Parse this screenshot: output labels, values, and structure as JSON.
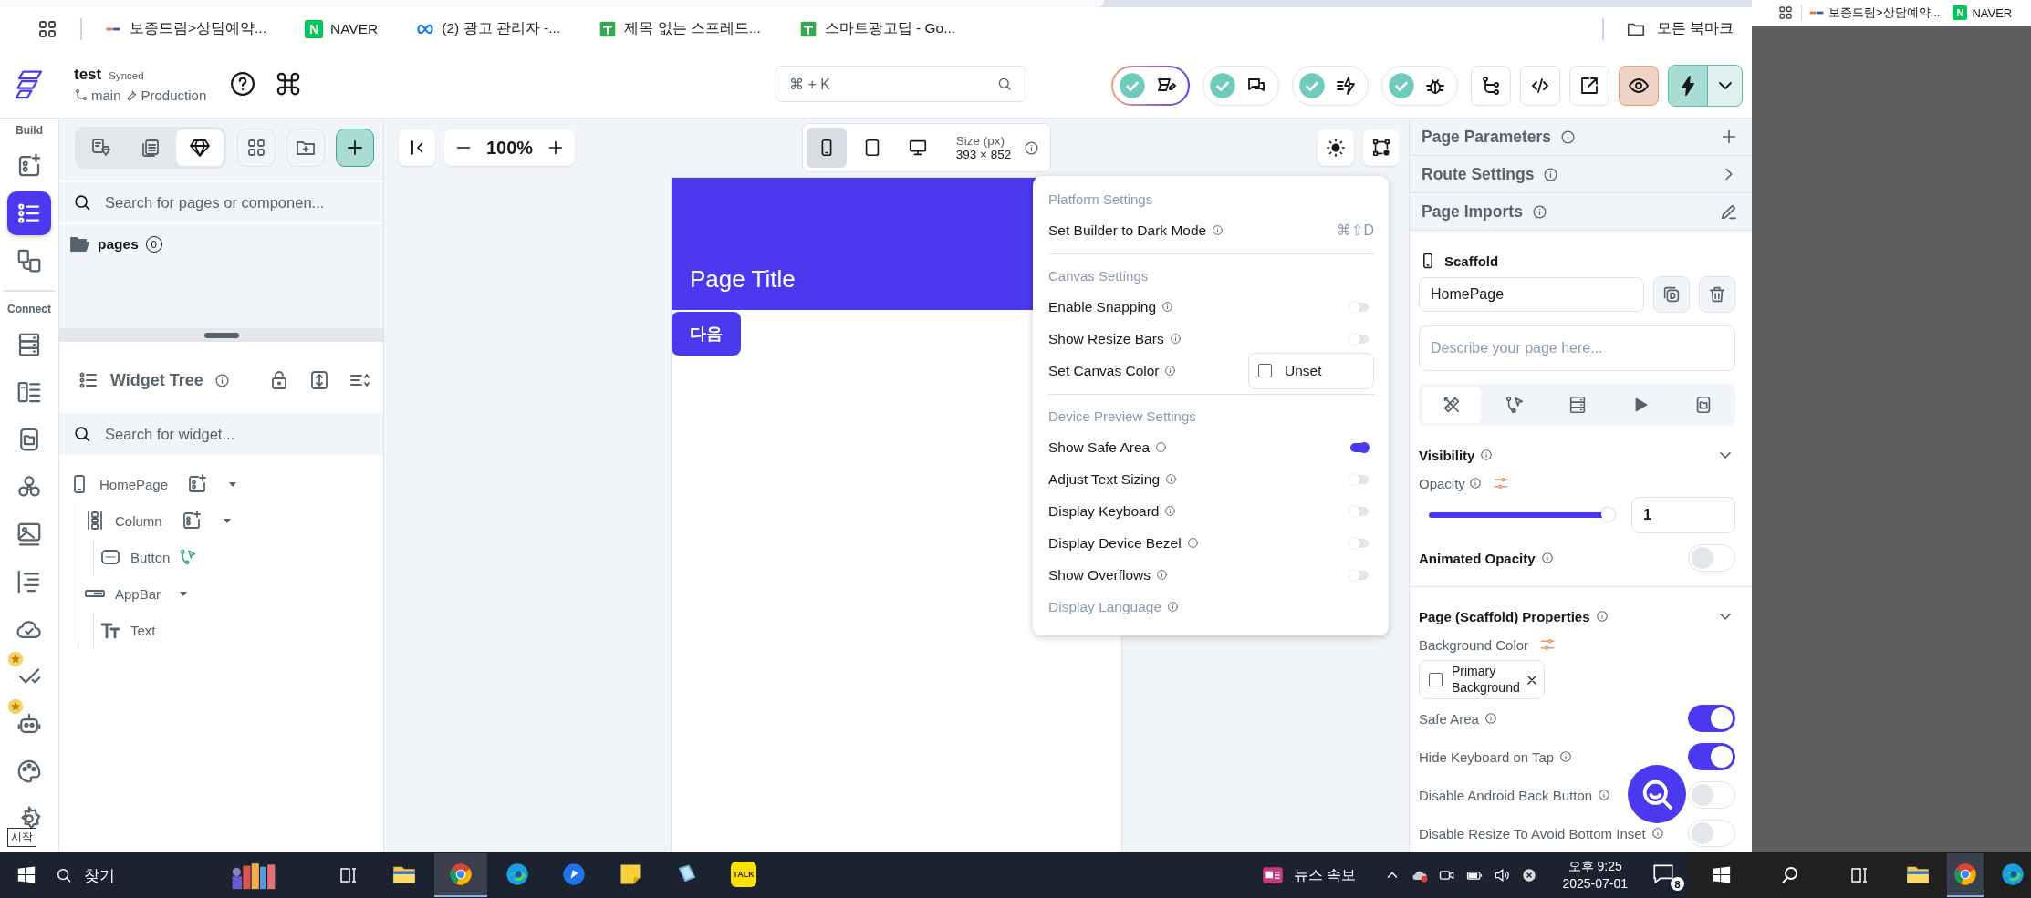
{
  "browser": {
    "bookmarks": [
      {
        "label": "보증드림>상담예약...",
        "kind": "brand"
      },
      {
        "label": "NAVER",
        "kind": "naver",
        "badge": "N"
      },
      {
        "label": "(2) 광고 관리자 -...",
        "kind": "meta"
      },
      {
        "label": "제목 없는 스프레드...",
        "kind": "sheets"
      },
      {
        "label": "스마트광고딥 - Go...",
        "kind": "sheets"
      }
    ],
    "all_bookmarks": "모든 북마크"
  },
  "project": {
    "name": "test",
    "sync": "Synced",
    "branch": "main",
    "environment": "Production"
  },
  "command_search": {
    "placeholder": "⌘ + K"
  },
  "rail": {
    "sections": [
      {
        "title": "Build",
        "items": [
          {
            "selected": false
          },
          {
            "selected": true
          },
          {
            "selected": false
          }
        ]
      },
      {
        "title": "Connect",
        "items": [
          {
            "selected": false
          },
          {
            "selected": false
          },
          {
            "selected": false
          },
          {
            "selected": false
          },
          {
            "selected": false
          },
          {
            "selected": false
          },
          {
            "selected": false
          },
          {
            "selected": false
          },
          {
            "selected": false
          },
          {
            "selected": false
          },
          {
            "selected": false
          }
        ]
      }
    ],
    "tooltip": "시작"
  },
  "pages_panel": {
    "tabs": [
      {
        "selected": false
      },
      {
        "selected": false
      },
      {
        "selected": true
      }
    ],
    "search": {
      "placeholder": "Search for pages or componen..."
    },
    "folders": [
      {
        "label": "pages",
        "count": "0"
      }
    ]
  },
  "widget_tree": {
    "title": "Widget Tree",
    "search": {
      "placeholder": "Search for widget..."
    },
    "nodes": [
      {
        "label": "HomePage",
        "kind": "page",
        "expanded": true,
        "children": [
          {
            "label": "Column",
            "kind": "column",
            "expanded": true,
            "children": [
              {
                "label": "Button",
                "kind": "button"
              }
            ]
          },
          {
            "label": "AppBar",
            "kind": "appbar",
            "expanded": true,
            "children": [
              {
                "label": "Text",
                "kind": "text"
              }
            ]
          }
        ]
      }
    ]
  },
  "canvas": {
    "zoom": "100%",
    "devices": [
      {
        "selected": true
      },
      {
        "selected": false
      },
      {
        "selected": false
      }
    ],
    "size_label": "Size (px)",
    "size_value": "393 × 852",
    "preview": {
      "app_bar_title": "Page Title",
      "button": "다음"
    }
  },
  "settings_menu": {
    "sections": [
      {
        "title": "Platform Settings",
        "items": [
          {
            "label": "Set Builder to Dark Mode",
            "kind": "shortcut",
            "shortcut": "⌘⇧D",
            "disabled": false
          }
        ]
      },
      {
        "title": "Canvas Settings",
        "items": [
          {
            "label": "Enable Snapping",
            "kind": "toggle",
            "on": false,
            "disabled": false
          },
          {
            "label": "Show Resize Bars",
            "kind": "toggle",
            "on": false,
            "disabled": false
          },
          {
            "label": "Set Canvas Color",
            "kind": "color",
            "value": "Unset",
            "disabled": false
          }
        ]
      },
      {
        "title": "Device Preview Settings",
        "items": [
          {
            "label": "Show Safe Area",
            "kind": "toggle",
            "on": true,
            "disabled": false
          },
          {
            "label": "Adjust Text Sizing",
            "kind": "toggle",
            "on": false,
            "disabled": false
          },
          {
            "label": "Display Keyboard",
            "kind": "toggle",
            "on": false,
            "disabled": false
          },
          {
            "label": "Display Device Bezel",
            "kind": "toggle",
            "on": false,
            "disabled": false
          },
          {
            "label": "Show Overflows",
            "kind": "toggle",
            "on": false,
            "disabled": false
          },
          {
            "label": "Display Language",
            "kind": "plain",
            "disabled": true
          }
        ]
      }
    ]
  },
  "properties": {
    "sections": [
      "Page Parameters",
      "Route Settings",
      "Page Imports"
    ],
    "widget": "Scaffold",
    "name": "HomePage",
    "description": {
      "placeholder": "Describe your page here..."
    },
    "tabs": [
      {
        "selected": true
      },
      {
        "selected": false
      },
      {
        "selected": false
      },
      {
        "selected": false
      },
      {
        "selected": false
      }
    ],
    "visibility": {
      "title": "Visibility",
      "expanded": true,
      "opacity_label": "Opacity",
      "level": 1,
      "opacity_value": "1",
      "animated_label": "Animated Opacity",
      "animated_on": false
    },
    "scaffold": {
      "title": "Page (Scaffold) Properties",
      "expanded": true,
      "background_label": "Background Color",
      "background_value": "Primary Background",
      "switches": [
        {
          "label": "Safe Area",
          "on": true
        },
        {
          "label": "Hide Keyboard on Tap",
          "on": true
        },
        {
          "label": "Disable Android Back Button",
          "on": false
        },
        {
          "label": "Disable Resize To Avoid Bottom Inset",
          "on": false
        }
      ]
    }
  },
  "taskbar": {
    "search_placeholder": "찾기",
    "apps": [
      {
        "kind": "explorer",
        "selected": false
      },
      {
        "kind": "chrome",
        "selected": true
      },
      {
        "kind": "edge",
        "selected": false
      },
      {
        "kind": "blue",
        "selected": false
      },
      {
        "kind": "notes",
        "selected": false
      },
      {
        "kind": "book",
        "selected": false
      },
      {
        "kind": "kakao",
        "selected": false,
        "label": "TALK"
      }
    ],
    "news": "뉴스 속보",
    "time": "오후 9:25",
    "date": "2025-07-01",
    "notifications": "8"
  },
  "second_screen": {
    "bookmarks": [
      {
        "label": "보증드림>상담예약...",
        "kind": "brand"
      },
      {
        "label": "NAVER",
        "kind": "naver",
        "badge": "N"
      }
    ],
    "apps": [
      {
        "kind": "explorer",
        "selected": false
      },
      {
        "kind": "chrome",
        "selected": true
      },
      {
        "kind": "edge",
        "selected": false
      }
    ]
  }
}
